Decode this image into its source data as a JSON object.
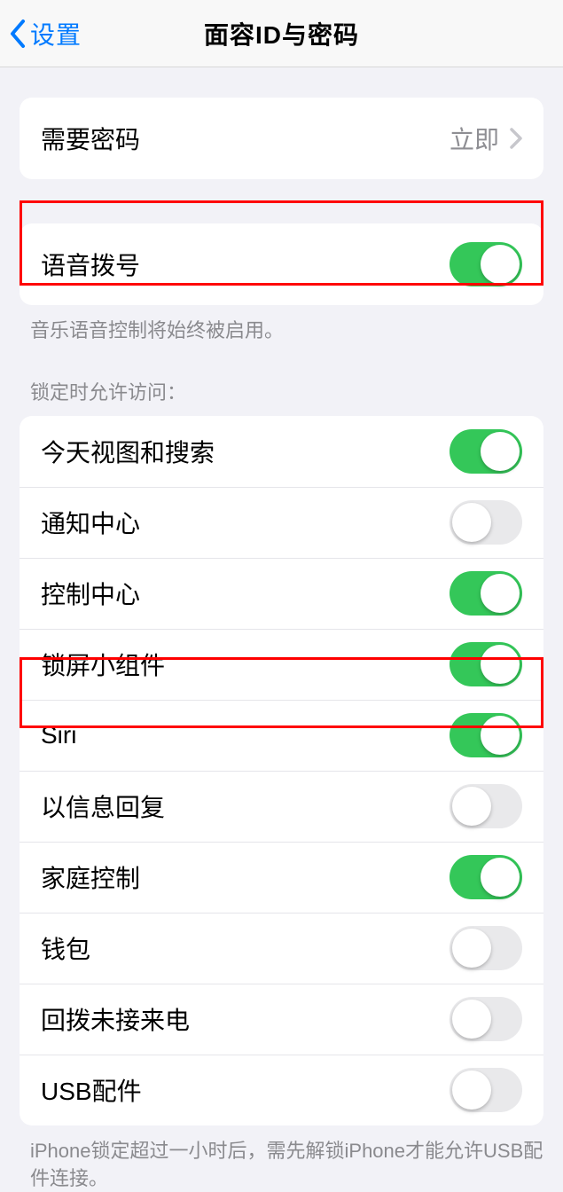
{
  "nav": {
    "back_label": "设置",
    "title": "面容ID与密码"
  },
  "passcode_group": {
    "label": "需要密码",
    "value": "立即"
  },
  "voice_group": {
    "label": "语音拨号",
    "toggle_on": true,
    "footer": "音乐语音控制将始终被启用。"
  },
  "lock_header": "锁定时允许访问：",
  "lock_items": [
    {
      "label": "今天视图和搜索",
      "on": true
    },
    {
      "label": "通知中心",
      "on": false
    },
    {
      "label": "控制中心",
      "on": true
    },
    {
      "label": "锁屏小组件",
      "on": true
    },
    {
      "label": "Siri",
      "on": true
    },
    {
      "label": "以信息回复",
      "on": false
    },
    {
      "label": "家庭控制",
      "on": true
    },
    {
      "label": "钱包",
      "on": false
    },
    {
      "label": "回拨未接来电",
      "on": false
    },
    {
      "label": "USB配件",
      "on": false
    }
  ],
  "usb_footer": "iPhone锁定超过一小时后，需先解锁iPhone才能允许USB配件连接。"
}
